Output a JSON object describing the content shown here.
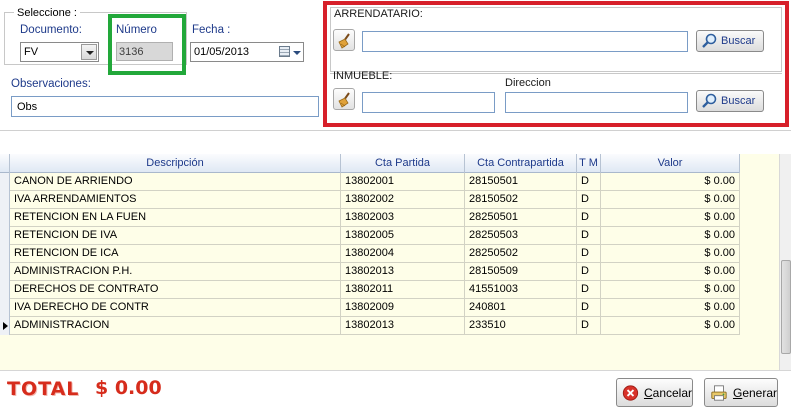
{
  "header": {
    "seleccione_label": "Seleccione :",
    "documento_label": "Documento:",
    "documento_value": "FV",
    "numero_label": "Número",
    "numero_value": "3136",
    "fecha_label": "Fecha :",
    "fecha_value": "01/05/2013",
    "observaciones_label": "Observaciones:",
    "observaciones_value": "Obs"
  },
  "search_panel": {
    "arrendatario_label": "ARRENDATARIO:",
    "arrendatario_value": "",
    "inmueble_label": "INMUEBLE:",
    "inmueble_value": "",
    "direccion_label": "Direccion",
    "direccion_value": "",
    "buscar_label": "Buscar"
  },
  "table": {
    "columns": [
      "Descripción",
      "Cta Partida",
      "Cta Contrapartida",
      "T M",
      "Valor"
    ],
    "rows": [
      [
        "CANON DE ARRIENDO",
        "13802001",
        "28150501",
        "D",
        "$ 0.00"
      ],
      [
        "IVA ARRENDAMIENTOS",
        "13802002",
        "28150502",
        "D",
        "$ 0.00"
      ],
      [
        "RETENCION EN LA FUEN",
        "13802003",
        "28250501",
        "D",
        "$ 0.00"
      ],
      [
        "RETENCION DE IVA",
        "13802005",
        "28250503",
        "D",
        "$ 0.00"
      ],
      [
        "RETENCION DE ICA",
        "13802004",
        "28250502",
        "D",
        "$ 0.00"
      ],
      [
        "ADMINISTRACION P.H.",
        "13802013",
        "28150509",
        "D",
        "$ 0.00"
      ],
      [
        "DERECHOS DE CONTRATO",
        "13802011",
        "41551003",
        "D",
        "$ 0.00"
      ],
      [
        "IVA DERECHO DE CONTR",
        "13802009",
        "240801",
        "D",
        "$ 0.00"
      ],
      [
        "ADMINISTRACION",
        "13802013",
        "233510",
        "D",
        "$ 0.00"
      ]
    ],
    "current_row_index": 8
  },
  "footer": {
    "total_label": "TOTAL",
    "total_value": "$ 0.00",
    "cancelar_label_first": "C",
    "cancelar_label_rest": "ancelar",
    "generar_label_first": "G",
    "generar_label_rest": "enerar"
  },
  "icons": {
    "broom": "broom-clear-icon",
    "search": "magnifier-icon",
    "cancel": "red-x-icon",
    "generate": "document-printer-icon"
  },
  "colors": {
    "red_highlight": "#d7202a",
    "green_highlight": "#22a83a",
    "total_red": "#d62c1c",
    "grid_bg": "#fefee8",
    "header_text": "#1e3a8a"
  }
}
